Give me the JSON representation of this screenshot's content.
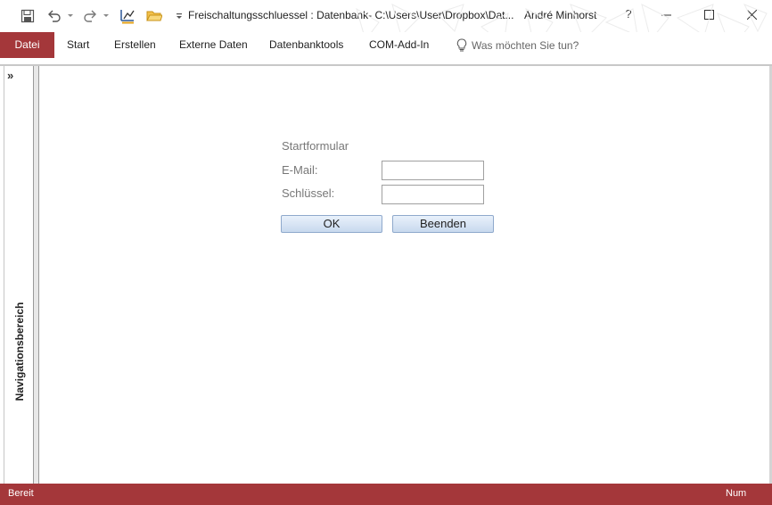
{
  "window": {
    "title": "Freischaltungsschluessel : Datenbank- C:\\Users\\User\\Dropbox\\Dat...",
    "user": "André Minhorst",
    "help": "?"
  },
  "qat": {
    "icons": [
      "save-icon",
      "undo-icon",
      "redo-icon",
      "design-icon",
      "open-folder-icon",
      "customize-dropdown-icon"
    ]
  },
  "ribbon": {
    "tabs": [
      {
        "label": "Datei"
      },
      {
        "label": "Start"
      },
      {
        "label": "Erstellen"
      },
      {
        "label": "Externe Daten"
      },
      {
        "label": "Datenbanktools"
      },
      {
        "label": "COM-Add-In"
      }
    ],
    "tellme": "Was möchten Sie tun?"
  },
  "nav": {
    "chevron": "»",
    "label": "Navigationsbereich"
  },
  "form": {
    "title": "Startformular",
    "email_label": "E-Mail:",
    "email_value": "",
    "key_label": "Schlüssel:",
    "key_value": "",
    "ok_label": "OK",
    "quit_label": "Beenden"
  },
  "status": {
    "left": "Bereit",
    "right": "Num"
  },
  "colors": {
    "accent": "#a4373a",
    "button_top": "#e9f1fb",
    "button_bottom": "#c8d9ee"
  }
}
